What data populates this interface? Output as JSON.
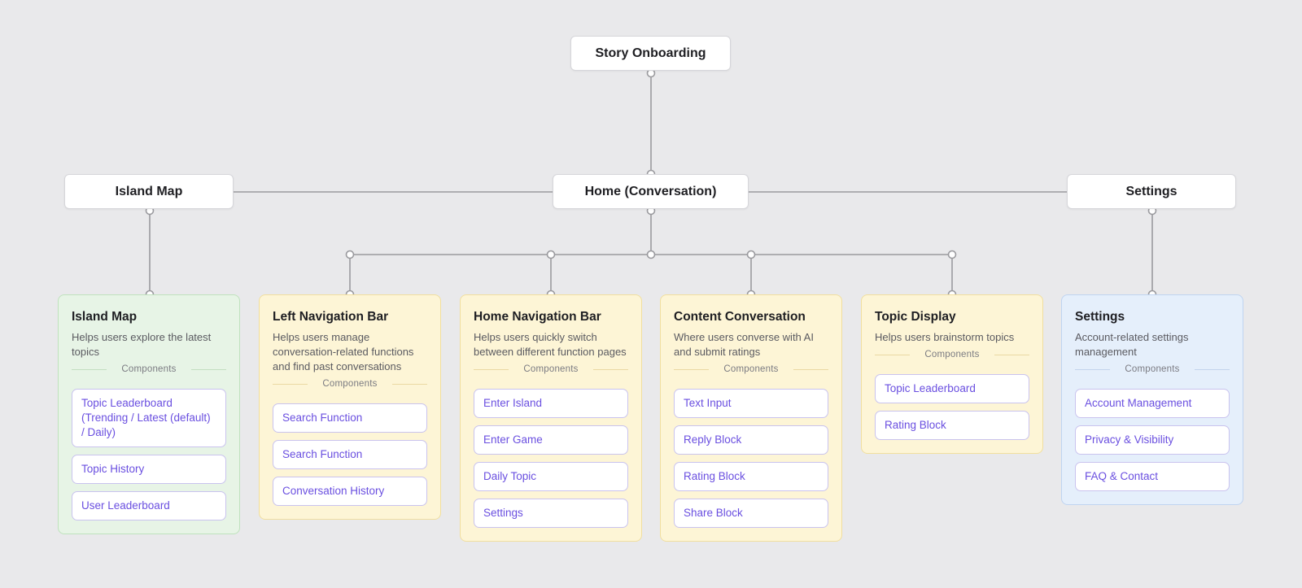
{
  "root": {
    "label": "Story Onboarding"
  },
  "level2": [
    {
      "id": "island",
      "label": "Island Map"
    },
    {
      "id": "home",
      "label": "Home (Conversation)"
    },
    {
      "id": "settings",
      "label": "Settings"
    }
  ],
  "components_label": "Components",
  "cards": [
    {
      "id": "island-map",
      "color": "green",
      "title": "Island Map",
      "desc": "Helps users explore the latest topics",
      "components": [
        "Topic Leaderboard (Trending / Latest (default) / Daily)",
        "Topic History",
        "User Leaderboard"
      ]
    },
    {
      "id": "left-nav",
      "color": "yellow",
      "title": "Left Navigation Bar",
      "desc": "Helps users manage conversation-related functions and find past conversations",
      "components": [
        "Search Function",
        "Search Function",
        "Conversation History"
      ]
    },
    {
      "id": "home-nav",
      "color": "yellow",
      "title": "Home Navigation Bar",
      "desc": "Helps users quickly switch between different function pages",
      "components": [
        "Enter Island",
        "Enter Game",
        "Daily Topic",
        "Settings"
      ]
    },
    {
      "id": "content-conv",
      "color": "yellow",
      "title": "Content Conversation",
      "desc": "Where users converse with AI and submit ratings",
      "components": [
        "Text Input",
        "Reply Block",
        "Rating Block",
        "Share Block"
      ]
    },
    {
      "id": "topic-display",
      "color": "yellow",
      "title": "Topic Display",
      "desc": "Helps users brainstorm topics",
      "components": [
        "Topic Leaderboard",
        "Rating Block"
      ]
    },
    {
      "id": "settings-card",
      "color": "blue",
      "title": "Settings",
      "desc": "Account-related settings management",
      "components": [
        "Account Management",
        "Privacy & Visibility",
        "FAQ & Contact"
      ]
    }
  ],
  "colors": {
    "wire": "#9a9a9e",
    "chip_text": "#6a4fe0",
    "green_bg": "#e7f4e6",
    "yellow_bg": "#fdf5d6",
    "blue_bg": "#e5effb"
  }
}
